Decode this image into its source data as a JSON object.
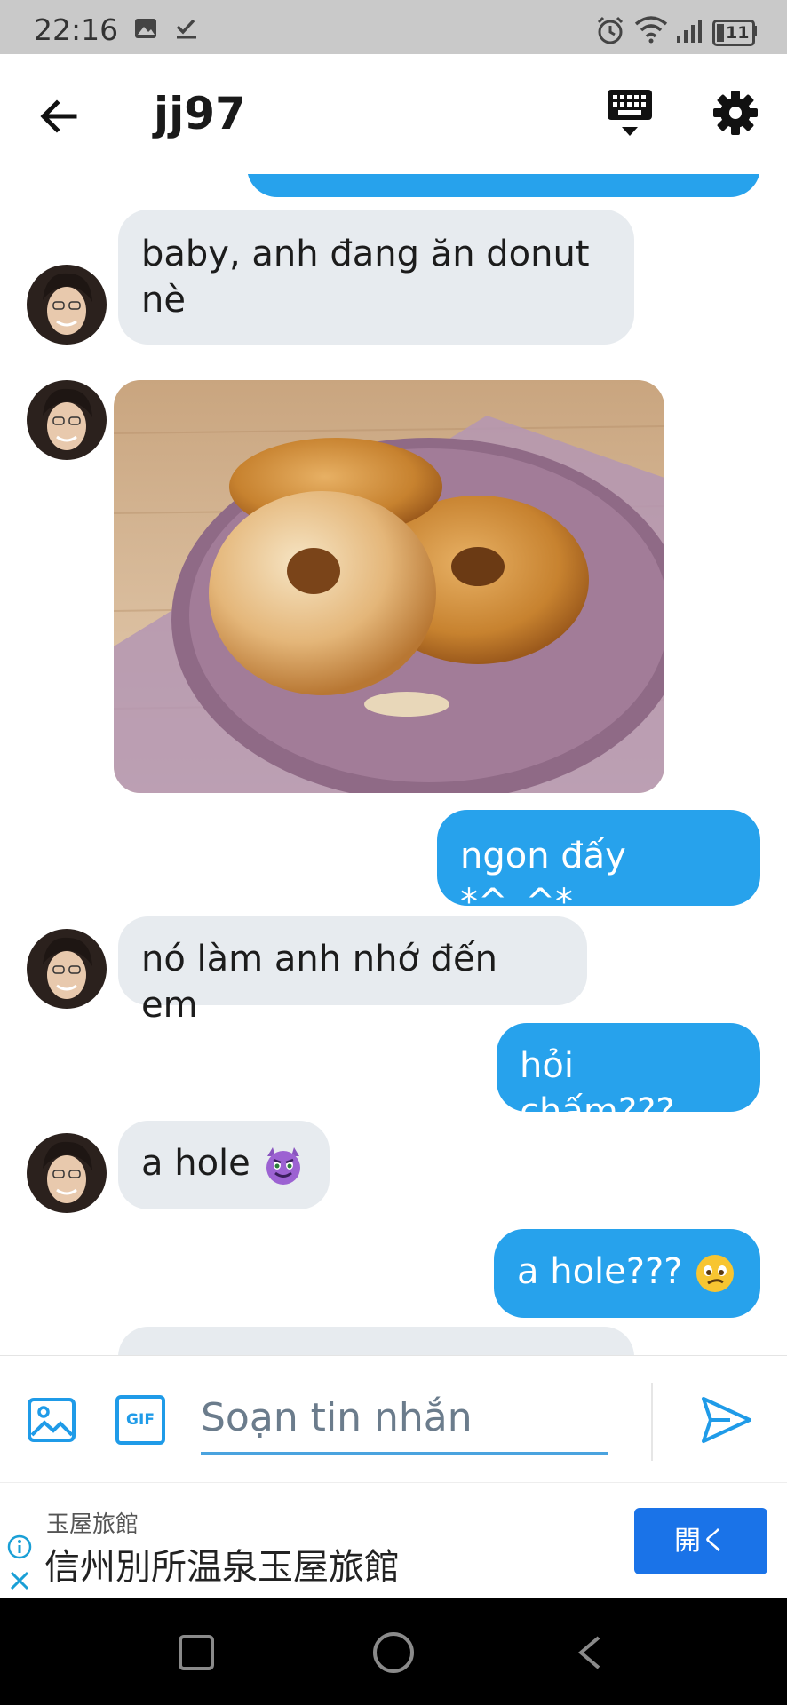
{
  "status": {
    "time": "22:16",
    "battery": "11"
  },
  "header": {
    "title": "jj97"
  },
  "messages": [
    {
      "side": "out",
      "text": ""
    },
    {
      "side": "in",
      "line1": "baby, anh đang ăn donut",
      "line2": "nè"
    },
    {
      "side": "in",
      "type": "image",
      "alt": "donuts"
    },
    {
      "side": "out",
      "text": "ngon đấy  *^_^*"
    },
    {
      "side": "in",
      "text": "nó làm anh nhớ đến em"
    },
    {
      "side": "out",
      "text": "hỏi chấm???"
    },
    {
      "side": "in",
      "text": "a hole",
      "emoji": "smiling-devil-emoji"
    },
    {
      "side": "out",
      "text": "a hole???",
      "emoji": "confused-emoji"
    },
    {
      "side": "in",
      "text": ""
    }
  ],
  "composer": {
    "placeholder": "Soạn tin nhắn",
    "gif_label": "GIF"
  },
  "ad": {
    "subtitle": "玉屋旅館",
    "title": "信州別所温泉玉屋旅館",
    "button": "開く"
  },
  "colors": {
    "accent": "#27a2ec",
    "incoming_bubble": "#e7ebef",
    "ad_button": "#1a73e8"
  }
}
